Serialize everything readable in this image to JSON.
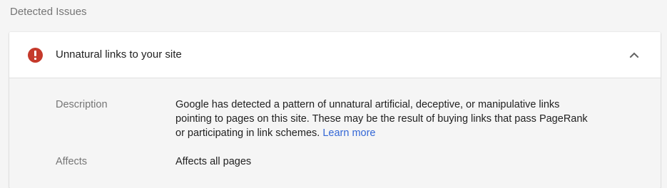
{
  "section": {
    "title": "Detected Issues"
  },
  "issue": {
    "title": "Unnatural links to your site",
    "icon": "error-icon",
    "icon_color": "#c5392b",
    "toggle_icon": "chevron-up-icon",
    "description_label": "Description",
    "description_text": "Google has detected a pattern of unnatural artificial, deceptive, or manipulative links pointing to pages on this site. These may be the result of buying links that pass PageRank or participating in link schemes.",
    "learn_more_label": "Learn more",
    "affects_label": "Affects",
    "affects_value": "Affects all pages"
  },
  "colors": {
    "accent_link": "#3367d6",
    "background": "#f5f5f5"
  }
}
